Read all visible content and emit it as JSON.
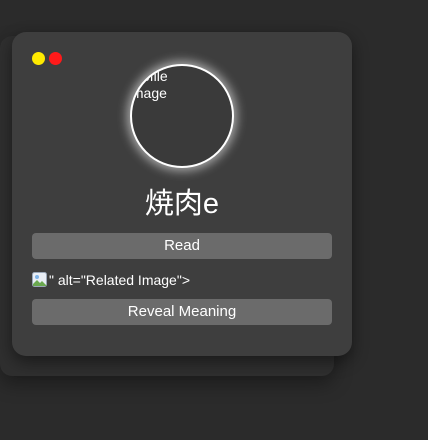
{
  "window": {
    "dots": [
      {
        "name": "yellow",
        "color": "#ffea00"
      },
      {
        "name": "red",
        "color": "#ff1a1a"
      }
    ]
  },
  "card": {
    "profile_alt": "Profile Image",
    "word": "焼肉e",
    "read_label": "Read",
    "related_text": "\" alt=\"Related Image\">",
    "reveal_label": "Reveal Meaning"
  },
  "icons": {
    "broken_image": "broken-image-icon"
  }
}
